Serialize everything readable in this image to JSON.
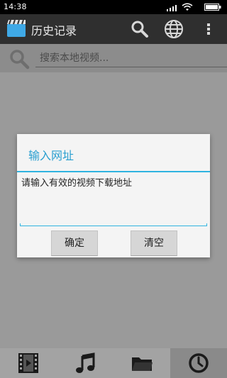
{
  "status_bar": {
    "time": "14:38"
  },
  "action_bar": {
    "title": "历史记录",
    "icons": [
      "app-icon",
      "search-icon",
      "globe-icon",
      "more-icon"
    ]
  },
  "search": {
    "placeholder": "搜索本地视频..."
  },
  "dialog": {
    "title": "输入网址",
    "input_value": "请输入有效的视频下载地址",
    "confirm_label": "确定",
    "clear_label": "清空"
  },
  "bottom_nav": {
    "tabs": [
      "video-icon",
      "music-icon",
      "folder-icon",
      "history-icon"
    ],
    "active": "history-icon"
  },
  "colors": {
    "accent": "#2fb3e0",
    "action_bar": "#2f2f2f",
    "overlay_bg": "#9a9a9a"
  }
}
